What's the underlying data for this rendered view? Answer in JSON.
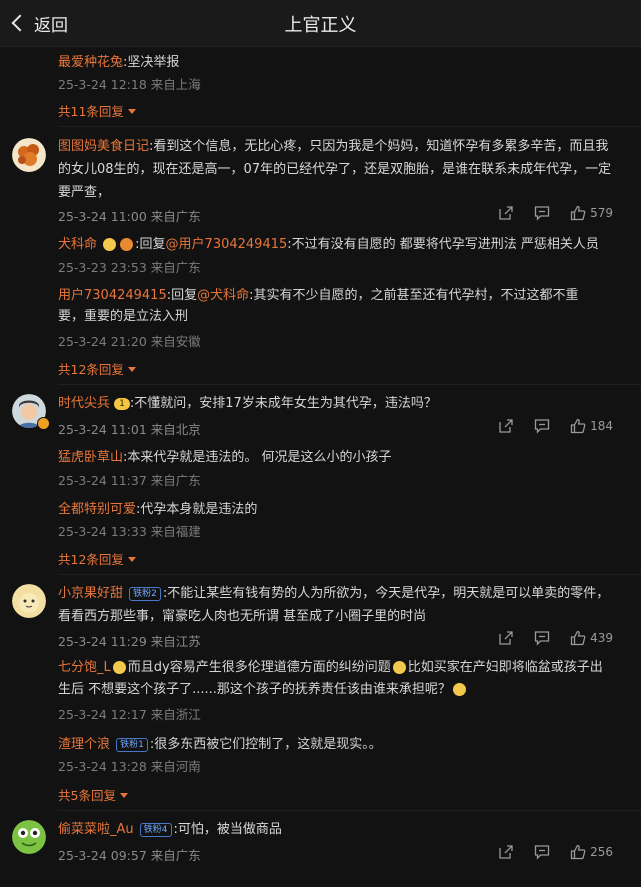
{
  "header": {
    "back_label": "返回",
    "title": "上官正义"
  },
  "thread0": {
    "reply": {
      "name": "最爱种花兔",
      "text": ":坚决举报",
      "meta": "25-3-24 12:18 来自上海"
    },
    "more": "共11条回复"
  },
  "c1": {
    "name": "图图妈美食日记",
    "text": ":看到这个信息，无比心疼，只因为我是个妈妈，知道怀孕有多累多辛苦，而且我的女儿08生的，现在还是高一，07年的已经代孕了，还是双胞胎，是谁在联系未成年代孕，一定要严查，",
    "meta": "25-3-24 11:00 来自广东",
    "likes": "579",
    "replies": [
      {
        "name": "犬科命",
        "pre": ":回复",
        "mention": "@用户7304249415",
        "text": ":不过有没有自愿的 都要将代孕写进刑法 严惩相关人员",
        "meta": "25-3-23 23:53 来自广东"
      },
      {
        "name": "用户7304249415",
        "pre": ":回复",
        "mention": "@犬科命",
        "text": ":其实有不少自愿的，之前甚至还有代孕村，不过这都不重要，重要的是立法入刑",
        "meta": "25-3-24 21:20 来自安徽"
      }
    ],
    "more": "共12条回复"
  },
  "c2": {
    "name": "时代尖兵",
    "level": "1",
    "text": ":不懂就问，安排17岁未成年女生为其代孕，违法吗？",
    "meta": "25-3-24 11:01 来自北京",
    "likes": "184",
    "replies": [
      {
        "name": "猛虎卧草山",
        "text": ":本来代孕就是违法的。 何况是这么小的小孩子",
        "meta": "25-3-24 11:37 来自广东"
      },
      {
        "name": "全都特别可爱",
        "text": ":代孕本身就是违法的",
        "meta": "25-3-24 13:33 来自福建"
      }
    ],
    "more": "共12条回复"
  },
  "c3": {
    "name": "小京果好甜",
    "badge": "铁粉2",
    "text": ":不能让某些有钱有势的人为所欲为，今天是代孕，明天就是可以单卖的零件，看看西方那些事，甯豪吃人肉也无所谓 甚至成了小圈子里的时尚",
    "meta": "25-3-24 11:29 来自江苏",
    "likes": "439",
    "replies": [
      {
        "name": "七分饱_L",
        "text": "而且dy容易产生很多伦理道德方面的纠纷问题",
        "text2": "比如买家在产妇即将临盆或孩子出生后 不想要这个孩子了......那这个孩子的抚养责任该由谁来承担呢？",
        "meta": "25-3-24 12:17 来自浙江"
      },
      {
        "name": "渣理个浪",
        "badge": "铁粉1",
        "text": ":很多东西被它们控制了，这就是现实。。",
        "meta": "25-3-24 13:28 来自河南"
      }
    ],
    "more": "共5条回复"
  },
  "c4": {
    "name": "偷菜菜啦_Au",
    "badge": "铁粉4",
    "text": ":可怕，被当做商品",
    "meta": "25-3-24 09:57 来自广东",
    "likes": "256"
  },
  "icons": [
    "share-icon",
    "comment-icon",
    "like-icon"
  ],
  "colors": {
    "accent": "#e8763b",
    "background": "#121212"
  }
}
